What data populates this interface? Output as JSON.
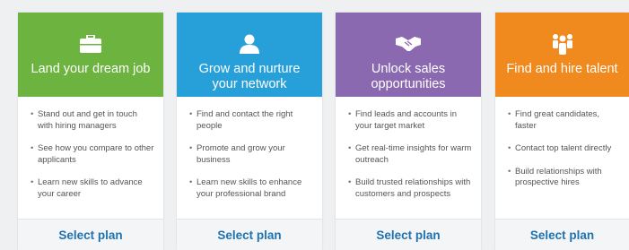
{
  "colors": {
    "green": "#6db33f",
    "blue": "#27a0da",
    "purple": "#8a69b0",
    "orange": "#f08a1f",
    "link": "#1f72b0"
  },
  "cards": [
    {
      "icon": "briefcase-icon",
      "title": "Land your dream job",
      "bullets": [
        "Stand out and get in touch with hiring managers",
        "See how you compare to other applicants",
        "Learn new skills to advance your career"
      ],
      "cta": "Select plan"
    },
    {
      "icon": "person-icon",
      "title": "Grow and nurture your network",
      "bullets": [
        "Find and contact the right people",
        "Promote and grow your business",
        "Learn new skills to enhance your professional brand"
      ],
      "cta": "Select plan"
    },
    {
      "icon": "handshake-icon",
      "title": "Unlock sales opportunities",
      "bullets": [
        "Find leads and accounts in your target market",
        "Get real-time insights for warm outreach",
        "Build trusted relationships with customers and prospects"
      ],
      "cta": "Select plan"
    },
    {
      "icon": "team-icon",
      "title": "Find and hire talent",
      "bullets": [
        "Find great candidates, faster",
        "Contact top talent directly",
        "Build relationships with prospective hires"
      ],
      "cta": "Select plan"
    }
  ]
}
